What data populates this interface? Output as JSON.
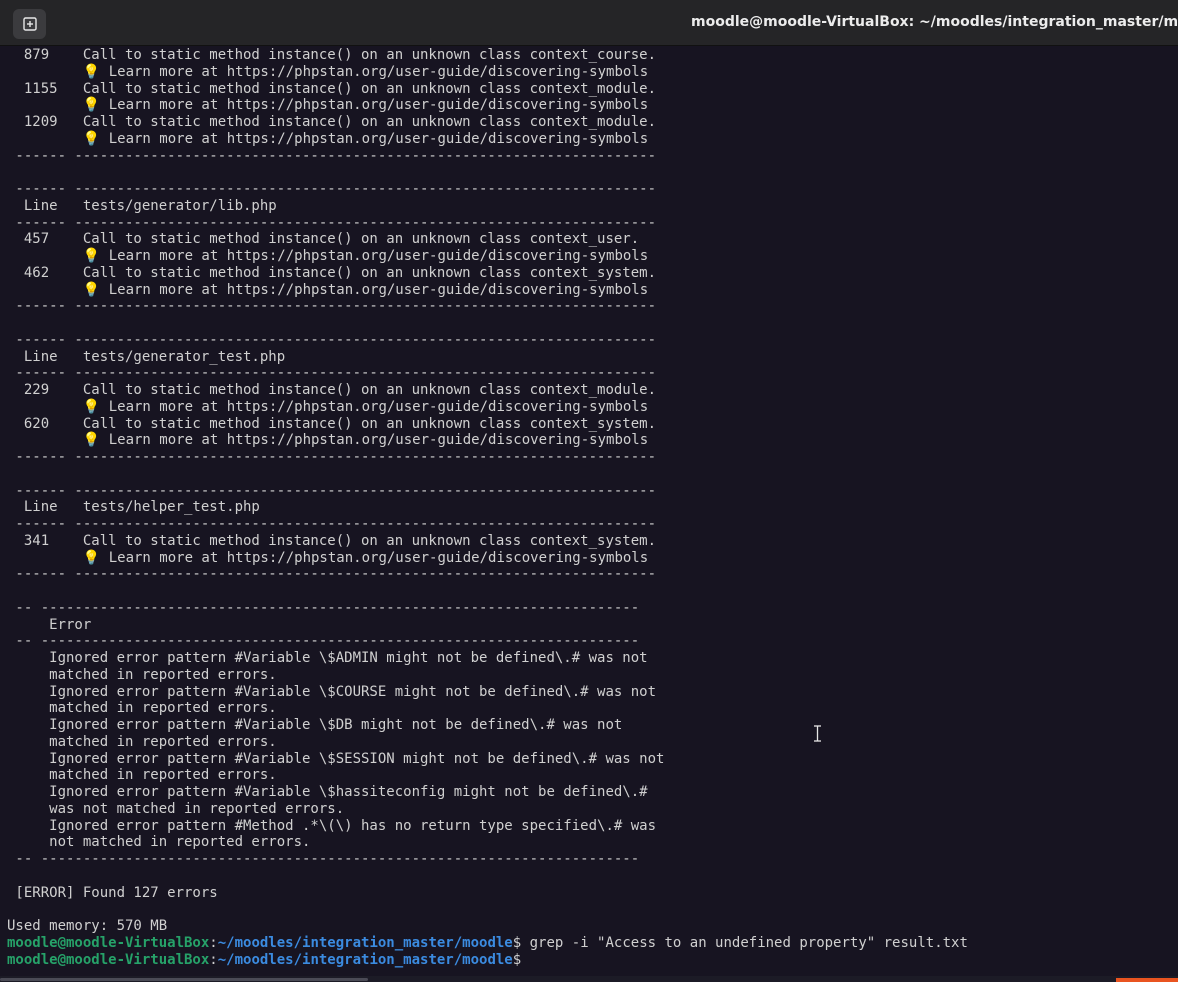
{
  "window": {
    "title": "moodle@moodle-VirtualBox: ~/moodles/integration_master/moodle"
  },
  "terminal": {
    "lines": [
      "  879    Call to static method instance() on an unknown class context_course.",
      "         💡 Learn more at https://phpstan.org/user-guide/discovering-symbols",
      "  1155   Call to static method instance() on an unknown class context_module.",
      "         💡 Learn more at https://phpstan.org/user-guide/discovering-symbols",
      "  1209   Call to static method instance() on an unknown class context_module.",
      "         💡 Learn more at https://phpstan.org/user-guide/discovering-symbols",
      " ------ ---------------------------------------------------------------------",
      "",
      " ------ ---------------------------------------------------------------------",
      "  Line   tests/generator/lib.php",
      " ------ ---------------------------------------------------------------------",
      "  457    Call to static method instance() on an unknown class context_user.",
      "         💡 Learn more at https://phpstan.org/user-guide/discovering-symbols",
      "  462    Call to static method instance() on an unknown class context_system.",
      "         💡 Learn more at https://phpstan.org/user-guide/discovering-symbols",
      " ------ ---------------------------------------------------------------------",
      "",
      " ------ ---------------------------------------------------------------------",
      "  Line   tests/generator_test.php",
      " ------ ---------------------------------------------------------------------",
      "  229    Call to static method instance() on an unknown class context_module.",
      "         💡 Learn more at https://phpstan.org/user-guide/discovering-symbols",
      "  620    Call to static method instance() on an unknown class context_system.",
      "         💡 Learn more at https://phpstan.org/user-guide/discovering-symbols",
      " ------ ---------------------------------------------------------------------",
      "",
      " ------ ---------------------------------------------------------------------",
      "  Line   tests/helper_test.php",
      " ------ ---------------------------------------------------------------------",
      "  341    Call to static method instance() on an unknown class context_system.",
      "         💡 Learn more at https://phpstan.org/user-guide/discovering-symbols",
      " ------ ---------------------------------------------------------------------",
      "",
      " -- -----------------------------------------------------------------------",
      "     Error",
      " -- -----------------------------------------------------------------------",
      "     Ignored error pattern #Variable \\$ADMIN might not be defined\\.# was not",
      "     matched in reported errors.",
      "     Ignored error pattern #Variable \\$COURSE might not be defined\\.# was not",
      "     matched in reported errors.",
      "     Ignored error pattern #Variable \\$DB might not be defined\\.# was not",
      "     matched in reported errors.",
      "     Ignored error pattern #Variable \\$SESSION might not be defined\\.# was not",
      "     matched in reported errors.",
      "     Ignored error pattern #Variable \\$hassiteconfig might not be defined\\.#",
      "     was not matched in reported errors.",
      "     Ignored error pattern #Method .*\\(\\) has no return type specified\\.# was",
      "     not matched in reported errors.",
      " -- -----------------------------------------------------------------------",
      "",
      " [ERROR] Found 127 errors",
      "",
      "Used memory: 570 MB"
    ],
    "prompt_user": "moodle@moodle-VirtualBox",
    "prompt_path": "~/moodles/integration_master/moodle",
    "prompt_separator": ":",
    "prompt_symbol": "$",
    "command": " grep -i \"Access to an undefined property\" result.txt",
    "second_prompt_user": "moodle@moodle-VirtualBox",
    "second_prompt_path": "~/moodles/integration_master/moodle",
    "second_prompt_symbol": "$",
    "colors": {
      "background": "#171421",
      "user": "#26a269",
      "path": "#3b8be0",
      "accent": "#e95420"
    }
  }
}
